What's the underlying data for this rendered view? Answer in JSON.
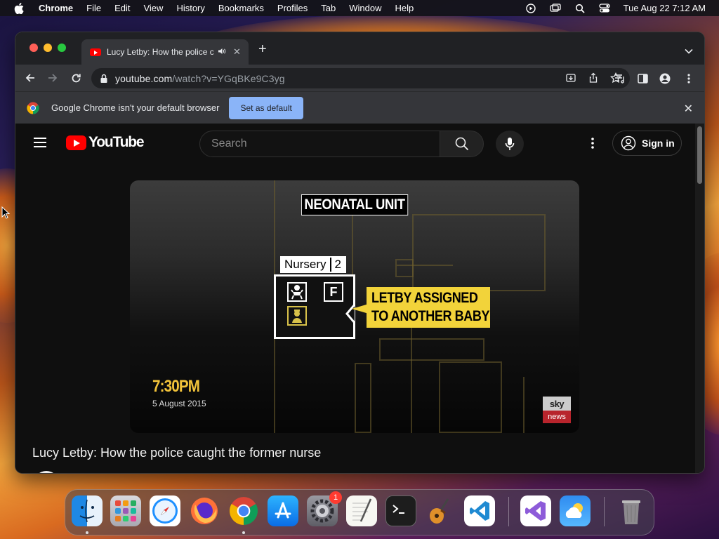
{
  "menubar": {
    "app": "Chrome",
    "items": [
      "File",
      "Edit",
      "View",
      "History",
      "Bookmarks",
      "Profiles",
      "Tab",
      "Window",
      "Help"
    ],
    "clock": "Tue Aug 22  7:12 AM"
  },
  "browser": {
    "tab": {
      "title": "Lucy Letby: How the police caught the former nurse",
      "favicon": "youtube-icon",
      "audio": "speaker-icon"
    },
    "new_tab": "+",
    "url_host": "youtube.com",
    "url_path": "/watch?v=YGqBKe9C3yg",
    "infobar": {
      "message": "Google Chrome isn't your default browser",
      "button": "Set as default"
    }
  },
  "youtube": {
    "logo_text": "YouTube",
    "search_placeholder": "Search",
    "sign_in": "Sign in",
    "video": {
      "title": "Lucy Letby: How the police caught the former nurse",
      "overlay": {
        "heading": "NEONATAL UNIT",
        "nursery_label": "Nursery",
        "nursery_number": "2",
        "cell_letter": "F",
        "callout_line1": "LETBY ASSIGNED",
        "callout_line2": "TO ANOTHER BABY",
        "time": "7:30PM",
        "date": "5 August 2015",
        "brand_top": "sky",
        "brand_bottom": "news"
      }
    }
  },
  "dock": {
    "apps": [
      "Finder",
      "Launchpad",
      "Safari",
      "Firefox",
      "Chrome",
      "App Store",
      "System Settings",
      "TextEdit",
      "Terminal",
      "GarageBand",
      "Visual Studio Code",
      "Visual Studio",
      "Weather",
      "Trash"
    ],
    "settings_badge": "1"
  },
  "colors": {
    "accent": "#8ab4f8",
    "youtube_red": "#ff0000",
    "callout_yellow": "#f2d33a"
  }
}
